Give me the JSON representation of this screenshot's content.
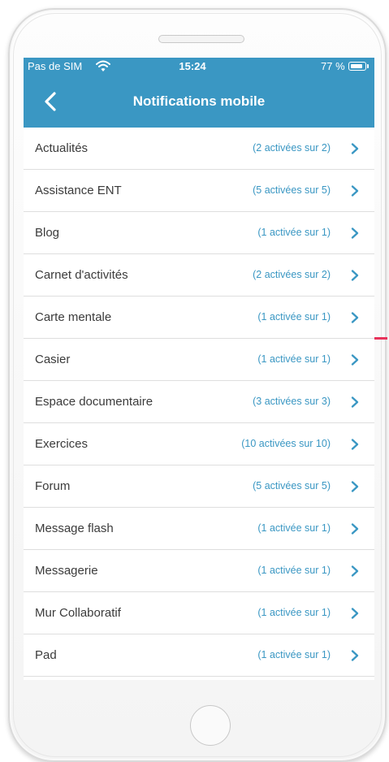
{
  "status_bar": {
    "carrier": "Pas de SIM",
    "time": "15:24",
    "battery": "77 %",
    "icons": [
      "wifi-icon",
      "battery-icon"
    ]
  },
  "nav": {
    "title": "Notifications mobile",
    "back_icon": "chevron-left-icon"
  },
  "colors": {
    "header": "#3a97c3",
    "status_text": "#3a97c3",
    "label_text": "#3b3b3b",
    "divider": "#dedede"
  },
  "list": {
    "items": [
      {
        "label": "Actualités",
        "status": "(2 activées sur 2)"
      },
      {
        "label": "Assistance ENT",
        "status": "(5 activées sur 5)"
      },
      {
        "label": "Blog",
        "status": "(1 activée sur 1)"
      },
      {
        "label": "Carnet d'activités",
        "status": "(2 activées sur 2)"
      },
      {
        "label": "Carte mentale",
        "status": "(1 activée sur 1)"
      },
      {
        "label": "Casier",
        "status": "(1 activée sur 1)"
      },
      {
        "label": "Espace documentaire",
        "status": "(3 activées sur 3)"
      },
      {
        "label": "Exercices",
        "status": "(10 activées sur 10)"
      },
      {
        "label": "Forum",
        "status": "(5 activées sur 5)"
      },
      {
        "label": "Message flash",
        "status": "(1 activée sur 1)"
      },
      {
        "label": "Messagerie",
        "status": "(1 activée sur 1)"
      },
      {
        "label": "Mur Collaboratif",
        "status": "(1 activée sur 1)"
      },
      {
        "label": "Pad",
        "status": "(1 activée sur 1)"
      }
    ]
  }
}
